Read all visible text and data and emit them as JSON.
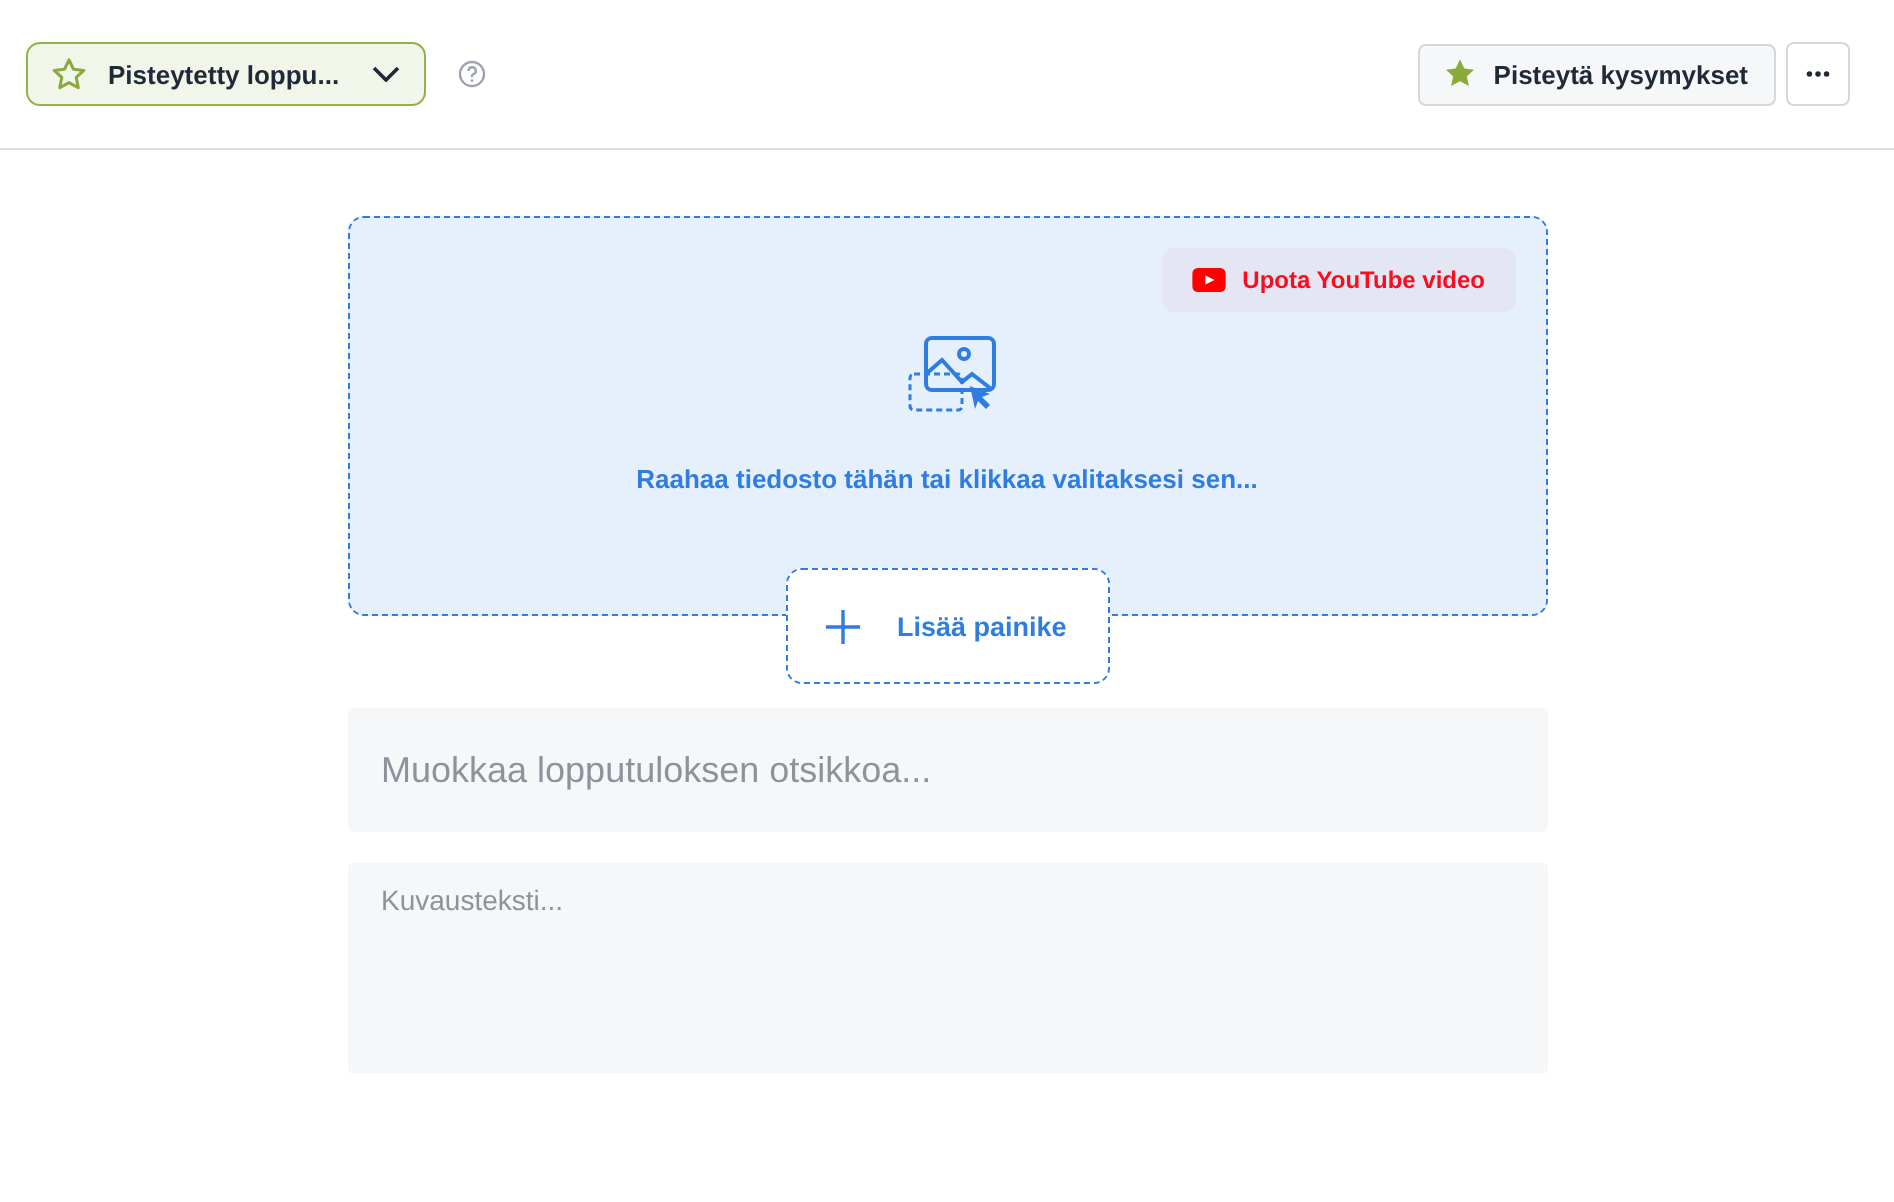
{
  "header": {
    "result_dropdown": {
      "label": "Pisteytetty loppu..."
    },
    "score_button": {
      "label": "Pisteytä kysymykset"
    }
  },
  "media": {
    "youtube_button": {
      "label": "Upota YouTube video"
    },
    "drop_hint": "Raahaa tiedosto tähän tai klikkaa valitaksesi sen...",
    "add_button": {
      "label": "Lisää painike"
    }
  },
  "title_field": {
    "placeholder": "Muokkaa lopputuloksen otsikkoa..."
  },
  "description_field": {
    "placeholder": "Kuvausteksti..."
  }
}
